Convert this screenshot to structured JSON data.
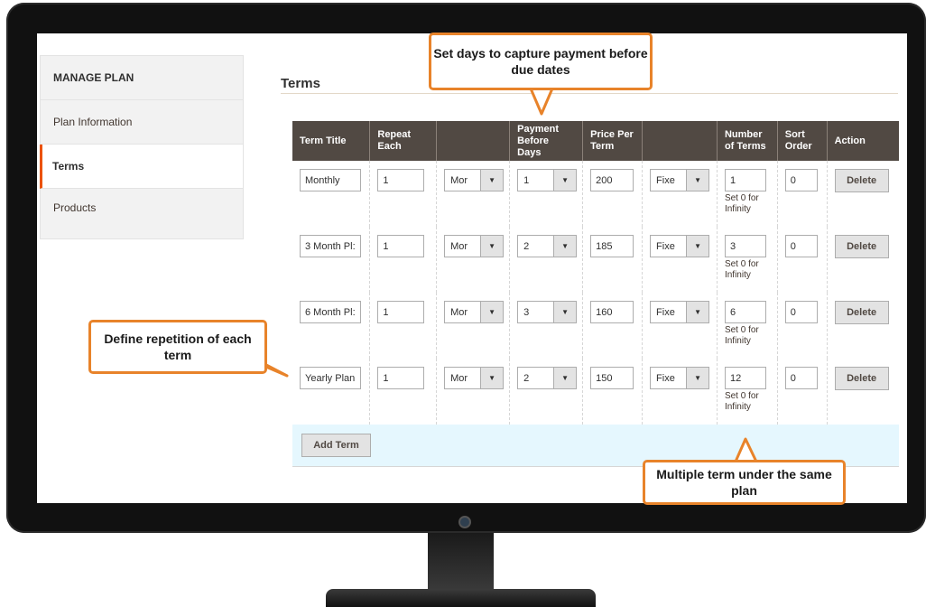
{
  "sidebar": {
    "heading": "MANAGE PLAN",
    "items": [
      {
        "label": "Plan Information"
      },
      {
        "label": "Terms"
      },
      {
        "label": "Products"
      }
    ]
  },
  "section_title": "Terms",
  "table": {
    "headers": [
      "Term Title",
      "Repeat Each",
      "",
      "Payment Before Days",
      "Price Per Term",
      "",
      "Number of Terms",
      "Sort Order",
      "Action"
    ],
    "rows": [
      {
        "title": "Monthly",
        "repeat": "1",
        "unit": "Mor",
        "payment_days": "1",
        "price": "200",
        "price_type": "Fixe",
        "num_terms": "1",
        "note": "Set 0 for Infinity",
        "sort": "0",
        "action": "Delete"
      },
      {
        "title": "3 Month Pl:",
        "repeat": "1",
        "unit": "Mor",
        "payment_days": "2",
        "price": "185",
        "price_type": "Fixe",
        "num_terms": "3",
        "note": "Set 0 for Infinity",
        "sort": "0",
        "action": "Delete"
      },
      {
        "title": "6 Month Pl:",
        "repeat": "1",
        "unit": "Mor",
        "payment_days": "3",
        "price": "160",
        "price_type": "Fixe",
        "num_terms": "6",
        "note": "Set 0 for Infinity",
        "sort": "0",
        "action": "Delete"
      },
      {
        "title": "Yearly Plan",
        "repeat": "1",
        "unit": "Mor",
        "payment_days": "2",
        "price": "150",
        "price_type": "Fixe",
        "num_terms": "12",
        "note": "Set 0 for Infinity",
        "sort": "0",
        "action": "Delete"
      }
    ],
    "add_label": "Add Term"
  },
  "callouts": {
    "top": "Set days to capture payment before due dates",
    "left": "Define repetition of each term",
    "bottom": "Multiple term under the same plan"
  },
  "colors": {
    "header_bg": "#514943",
    "active_accent": "#eb5202",
    "callout_border": "#e8832a",
    "footer_bg": "#e5f7fe"
  }
}
